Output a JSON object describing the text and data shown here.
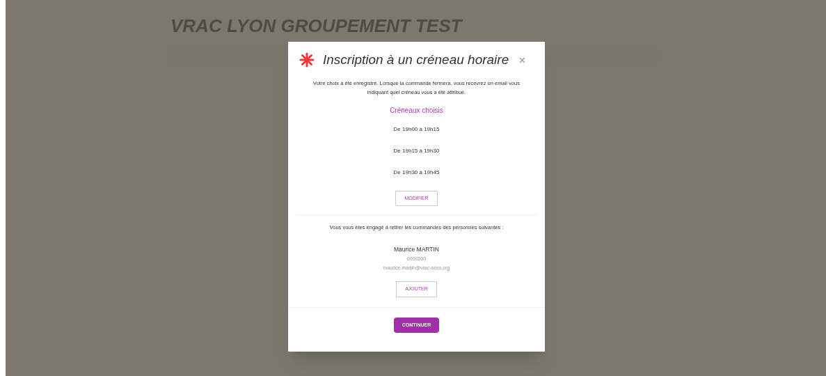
{
  "site": {
    "title": "VRAC LYON GROUPEMENT TEST"
  },
  "modal": {
    "title": "Inscription à un créneau horaire",
    "message": "Votre choix a été enregistré. Lorsque la commande fermera, vous recevrez un email vous indiquant quel créneau vous a été attribué.",
    "slots_heading": "Créneaux choisis",
    "slots": [
      "De 19h00 à 19h15",
      "De 19h15 à 19h30",
      "De 19h30 à 19h45"
    ],
    "modify_button": "MODIFIER",
    "commitment_text": "Vous vous êtes engagé à retirer les commandes des personnes suivantes :",
    "persons": [
      {
        "name": "Maurice MARTIN",
        "phone": "0000000",
        "email": "maurice.martin@vrac-asso.org"
      }
    ],
    "add_button": "AJOUTER",
    "continue_button": "CONTINUER"
  }
}
